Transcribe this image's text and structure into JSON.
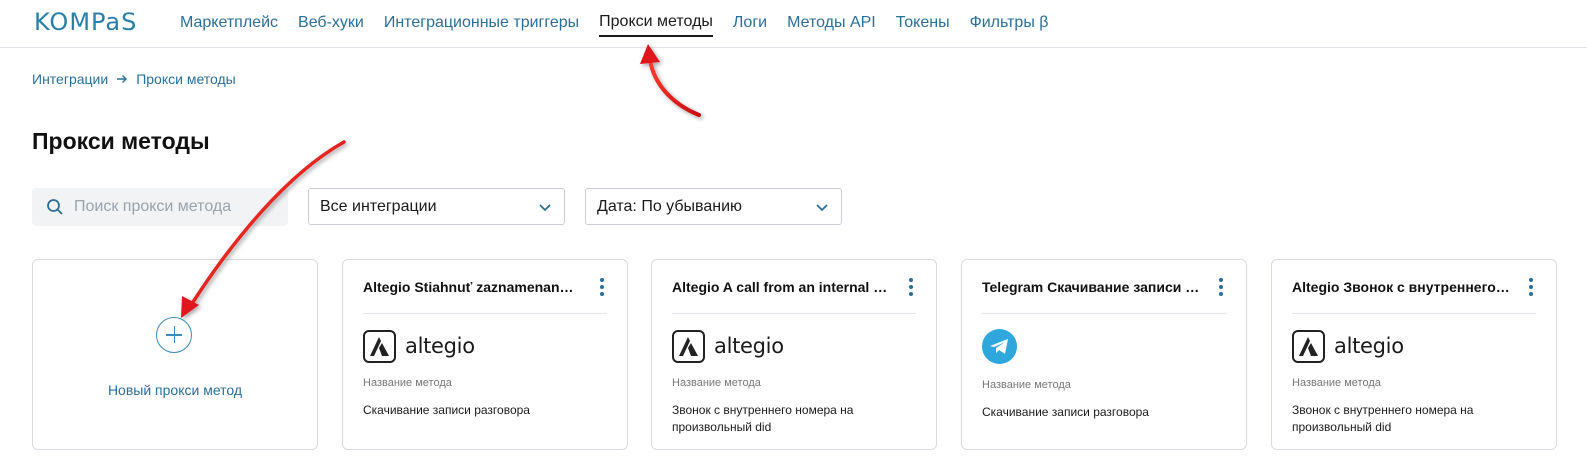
{
  "logo": {
    "text": "KOMPaS"
  },
  "nav": {
    "items": [
      {
        "label": "Маркетплейс"
      },
      {
        "label": "Веб-хуки"
      },
      {
        "label": "Интеграционные триггеры"
      },
      {
        "label": "Прокси методы",
        "active": true
      },
      {
        "label": "Логи"
      },
      {
        "label": "Методы API"
      },
      {
        "label": "Токены"
      },
      {
        "label": "Фильтры β"
      }
    ]
  },
  "breadcrumb": {
    "parent": "Интеграции",
    "current": "Прокси методы"
  },
  "page": {
    "title": "Прокси методы"
  },
  "search": {
    "placeholder": "Поиск прокси метода"
  },
  "filters": {
    "integration": "Все интеграции",
    "sort": "Дата: По убыванию"
  },
  "new_card": {
    "label": "Новый прокси метод"
  },
  "cards": [
    {
      "title": "Altegio Stiahnuť zaznamenané hovory",
      "brand": "altegio",
      "field_label": "Название метода",
      "field_value": "Скачивание записи разговора"
    },
    {
      "title": "Altegio A call from an internal number",
      "brand": "altegio",
      "field_label": "Название метода",
      "field_value": "Звонок с внутреннего номера на произвольный did"
    },
    {
      "title": "Telegram Скачивание записи разговора",
      "brand": "telegram",
      "field_label": "Название метода",
      "field_value": "Скачивание записи разговора"
    },
    {
      "title": "Altegio Звонок с внутреннего номера",
      "brand": "altegio",
      "field_label": "Название метода",
      "field_value": "Звонок с внутреннего номера на произвольный did"
    }
  ],
  "colors": {
    "accent": "#2b6f97",
    "annotation_arrow": "#e0151b",
    "telegram": "#2ea7dc"
  }
}
